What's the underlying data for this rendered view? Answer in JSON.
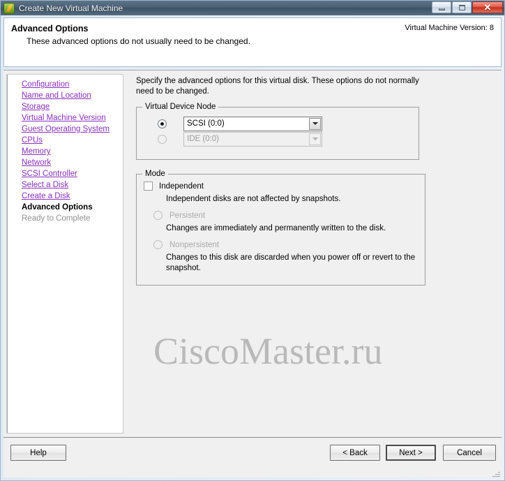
{
  "window": {
    "title": "Create New Virtual Machine",
    "icon": "vsphere-app-icon",
    "buttons": {
      "minimize": "minimize-icon",
      "maximize": "maximize-icon",
      "close": "✕"
    }
  },
  "header": {
    "title": "Advanced Options",
    "subtitle": "These advanced options do not usually need to be changed.",
    "version": "Virtual Machine Version: 8"
  },
  "nav": {
    "items": [
      {
        "label": "Configuration",
        "state": "link"
      },
      {
        "label": "Name and Location",
        "state": "link"
      },
      {
        "label": "Storage",
        "state": "link"
      },
      {
        "label": "Virtual Machine Version",
        "state": "link"
      },
      {
        "label": "Guest Operating System",
        "state": "link"
      },
      {
        "label": "CPUs",
        "state": "link"
      },
      {
        "label": "Memory",
        "state": "link"
      },
      {
        "label": "Network",
        "state": "link"
      },
      {
        "label": "SCSI Controller",
        "state": "link"
      },
      {
        "label": "Select a Disk",
        "state": "link"
      },
      {
        "label": "Create a Disk",
        "state": "link"
      },
      {
        "label": "Advanced Options",
        "state": "current"
      },
      {
        "label": "Ready to Complete",
        "state": "disabled"
      }
    ]
  },
  "main": {
    "intro": "Specify the advanced options for this virtual disk. These options do not normally need to be changed.",
    "device_node": {
      "legend": "Virtual Device Node",
      "scsi": {
        "value": "SCSI (0:0)",
        "selected": true
      },
      "ide": {
        "value": "IDE (0:0)",
        "selected": false
      }
    },
    "mode": {
      "legend": "Mode",
      "independent_label": "Independent",
      "independent_checked": false,
      "independent_desc": "Independent disks are not affected by snapshots.",
      "persistent_label": "Persistent",
      "persistent_desc": "Changes are immediately and permanently written to the disk.",
      "nonpersistent_label": "Nonpersistent",
      "nonpersistent_desc": "Changes to this disk are discarded when you power off or revert to the snapshot."
    },
    "watermark": "CiscoMaster.ru"
  },
  "footer": {
    "help": "Help",
    "back": "< Back",
    "next": "Next >",
    "cancel": "Cancel"
  },
  "colors": {
    "link": "#8a2fbb",
    "titlebar": "#4b6276",
    "close": "#c4301d",
    "body": "#f0f0f0"
  }
}
